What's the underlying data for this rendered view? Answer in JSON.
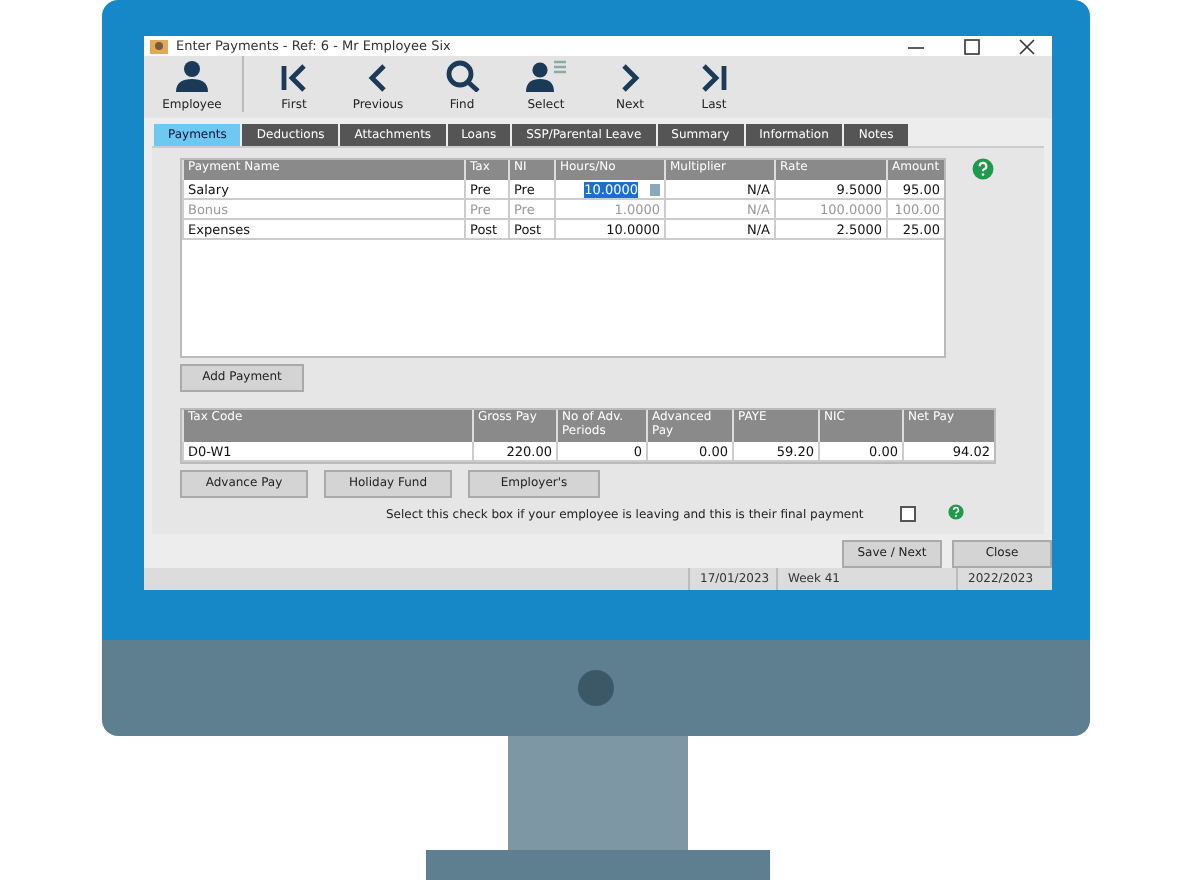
{
  "window": {
    "title": "Enter Payments - Ref: 6 - Mr Employee Six"
  },
  "toolbar": [
    {
      "kind": "person",
      "label": "Employee"
    },
    {
      "kind": "first",
      "label": "First"
    },
    {
      "kind": "previous",
      "label": "Previous"
    },
    {
      "kind": "find",
      "label": "Find"
    },
    {
      "kind": "select",
      "label": "Select"
    },
    {
      "kind": "next",
      "label": "Next"
    },
    {
      "kind": "last",
      "label": "Last"
    }
  ],
  "tabs": [
    {
      "label": "Payments",
      "selected": true
    },
    {
      "label": "Deductions",
      "selected": false
    },
    {
      "label": "Attachments",
      "selected": false
    },
    {
      "label": "Loans",
      "selected": false
    },
    {
      "label": "SSP/Parental Leave",
      "selected": false
    },
    {
      "label": "Summary",
      "selected": false
    },
    {
      "label": "Information",
      "selected": false
    },
    {
      "label": "Notes",
      "selected": false
    }
  ],
  "payments": {
    "columns": [
      "Payment Name",
      "Tax",
      "NI",
      "Hours/No",
      "Multiplier",
      "Rate",
      "Amount"
    ],
    "rows": [
      {
        "name": "Salary",
        "tax": "Pre",
        "ni": "Pre",
        "hours": "10.0000",
        "hours_selected": true,
        "multiplier": "N/A",
        "rate": "9.5000",
        "amount": "95.00",
        "disabled": false
      },
      {
        "name": "Bonus",
        "tax": "Pre",
        "ni": "Pre",
        "hours": "1.0000",
        "hours_selected": false,
        "multiplier": "N/A",
        "rate": "100.0000",
        "amount": "100.00",
        "disabled": true
      },
      {
        "name": "Expenses",
        "tax": "Post",
        "ni": "Post",
        "hours": "10.0000",
        "hours_selected": false,
        "multiplier": "N/A",
        "rate": "2.5000",
        "amount": "25.00",
        "disabled": false
      }
    ],
    "add_button": "Add Payment"
  },
  "totals": {
    "columns": [
      "Tax Code",
      "Gross Pay",
      "No of Adv. Periods",
      "Advanced Pay",
      "PAYE",
      "NIC",
      "Net Pay"
    ],
    "row": [
      "D0-W1",
      "220.00",
      "0",
      "0.00",
      "59.20",
      "0.00",
      "94.02"
    ]
  },
  "action_buttons": [
    "Advance Pay",
    "Holiday Fund",
    "Employer's"
  ],
  "final_payment": {
    "label": "Select this check box if your employee is leaving and this is their final payment",
    "checked": false
  },
  "footer_buttons": [
    "Save / Next",
    "Close"
  ],
  "status_bar": [
    "17/01/2023",
    "Week 41",
    "2022/2023"
  ]
}
